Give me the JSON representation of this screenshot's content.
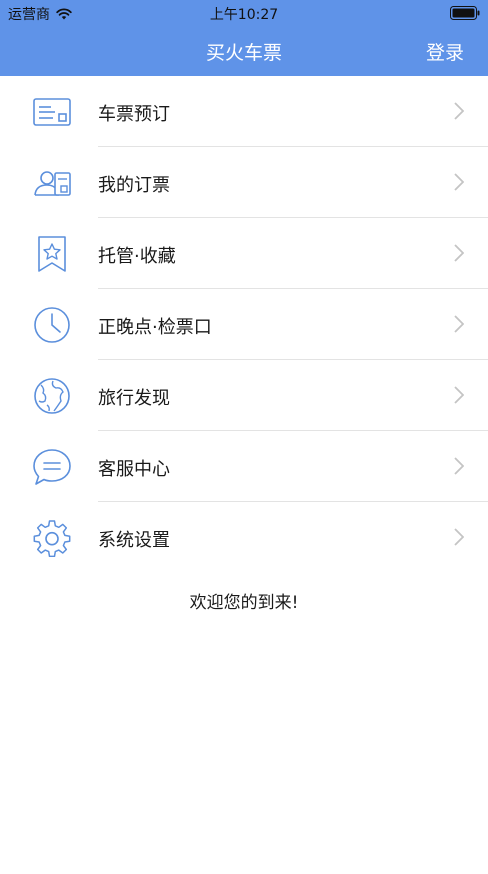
{
  "status_bar": {
    "carrier": "运营商",
    "time": "上午10:27"
  },
  "nav": {
    "title": "买火车票",
    "login_label": "登录"
  },
  "menu": {
    "items": [
      {
        "label": "车票预订",
        "icon": "ticket-card-icon"
      },
      {
        "label": "我的订票",
        "icon": "user-card-icon"
      },
      {
        "label": "托管·收藏",
        "icon": "bookmark-star-icon"
      },
      {
        "label": "正晚点·检票口",
        "icon": "clock-icon"
      },
      {
        "label": "旅行发现",
        "icon": "globe-icon"
      },
      {
        "label": "客服中心",
        "icon": "chat-bubble-icon"
      },
      {
        "label": "系统设置",
        "icon": "gear-icon"
      }
    ]
  },
  "welcome_text": "欢迎您的到来!",
  "colors": {
    "header": "#5f93e8",
    "icon": "#5b8fdc",
    "chevron": "#c4c4c4"
  }
}
